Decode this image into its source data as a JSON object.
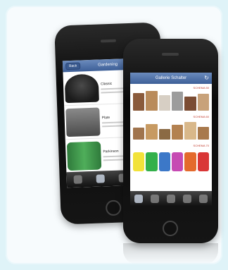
{
  "back_phone": {
    "nav_button": "Back",
    "nav_title": "Gardening",
    "items": [
      {
        "title": "Classic",
        "thumb_color": "#2b2b2b"
      },
      {
        "title": "Plate",
        "thumb_color": "#6b6b6b"
      },
      {
        "title": "Parkinson",
        "thumb_color": "#3f8f4a"
      }
    ]
  },
  "front_phone": {
    "nav_title": "Gallerie Schalter",
    "sections": [
      {
        "price": "SCHEMA 50",
        "colors": [
          "#8a5a3b",
          "#b98b5b",
          "#d7cfc4",
          "#9c9c9c",
          "#7b4c33",
          "#c8a27a"
        ]
      },
      {
        "price": "SCHEMA 60",
        "colors": [
          "#a0744d",
          "#c79a62",
          "#8b6a44",
          "#b38150",
          "#d9b88a",
          "#a8794c"
        ]
      },
      {
        "price": "SCHEMA 70",
        "colors": [
          "#f2e23a",
          "#33b04a",
          "#3c78c8",
          "#c64ab3",
          "#e46a2c",
          "#d93636"
        ]
      }
    ]
  },
  "colors": {
    "navbar_top": "#6b8bbd",
    "navbar_bottom": "#3d5f97",
    "background": "#dff3f8"
  }
}
